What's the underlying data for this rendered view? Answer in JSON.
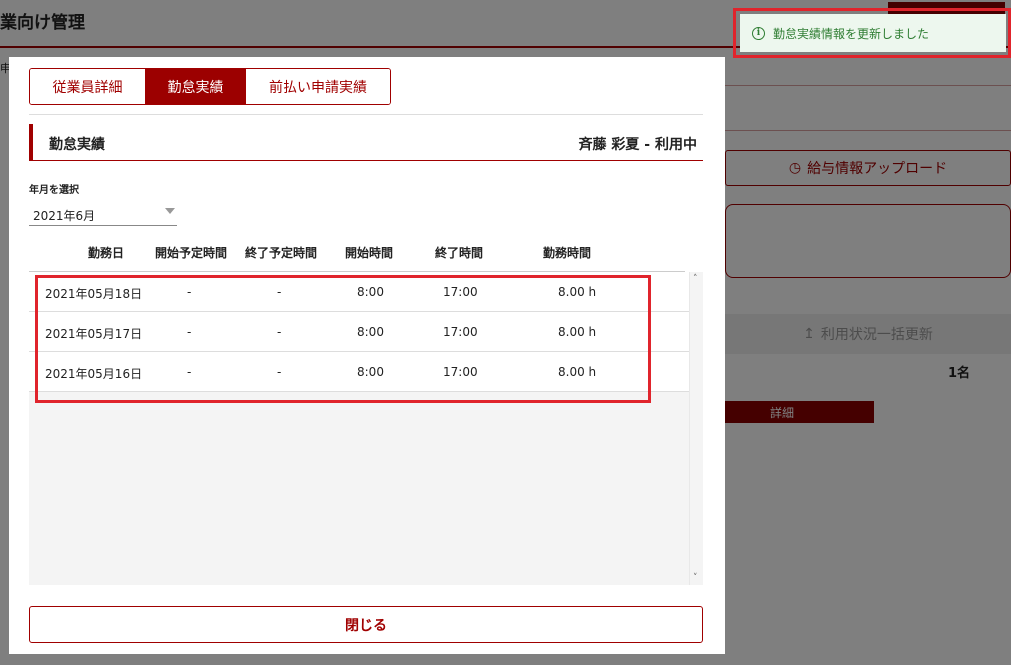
{
  "background": {
    "title": "業向け管理",
    "side_char": "申",
    "upload_button": "給与情報アップロード",
    "bulk_button": "利用状況一括更新",
    "count": "1名",
    "detail_button": "詳細"
  },
  "modal": {
    "tabs": [
      {
        "label": "従業員詳細",
        "active": false
      },
      {
        "label": "勤怠実績",
        "active": true
      },
      {
        "label": "前払い申請実績",
        "active": false
      }
    ],
    "section_title": "勤怠実績",
    "user_status": "斉藤 彩夏 - 利用中",
    "year_month_label": "年月を選択",
    "year_month_value": "2021年6月",
    "columns": [
      "勤務日",
      "開始予定時間",
      "終了予定時間",
      "開始時間",
      "終了時間",
      "勤務時間"
    ],
    "rows": [
      {
        "date": "2021年05月18日",
        "planned_start": "-",
        "planned_end": "-",
        "start": "8:00",
        "end": "17:00",
        "hours": "8.00 h"
      },
      {
        "date": "2021年05月17日",
        "planned_start": "-",
        "planned_end": "-",
        "start": "8:00",
        "end": "17:00",
        "hours": "8.00 h"
      },
      {
        "date": "2021年05月16日",
        "planned_start": "-",
        "planned_end": "-",
        "start": "8:00",
        "end": "17:00",
        "hours": "8.00 h"
      }
    ],
    "close_button": "閉じる"
  },
  "toast": {
    "message": "勤怠実績情報を更新しました",
    "icon": "info-icon"
  },
  "colors": {
    "accent": "#a00000",
    "toast_bg": "#edf7ee",
    "toast_text": "#2e7d32",
    "highlight": "#e0242c"
  }
}
